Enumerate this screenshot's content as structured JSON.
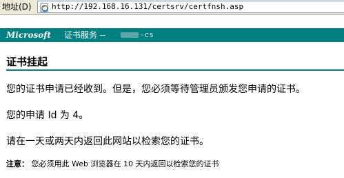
{
  "address_bar": {
    "label": "地址(D)",
    "url": "http://192.168.16.131/certsrv/certfnsh.asp"
  },
  "banner": {
    "brand": "Microsoft",
    "service": "证书服务 --",
    "server_suffix": "-cs"
  },
  "content": {
    "heading": "证书挂起",
    "paragraph_1": "您的证书申请已经收到。但是，您必须等待管理员颁发您申请的证书。",
    "paragraph_2": "您的申请 Id 为 4。",
    "paragraph_3": "请在一天或两天内返回此网站以检索您的证书。",
    "note_label": "注意：",
    "note_text": "您必须用此 Web 浏览器在 10 天内返回以检索您的证书"
  },
  "colors": {
    "banner_bg": "#008080",
    "rule": "#008080",
    "toolbar_bg": "#ece9d8"
  },
  "icons": {
    "page": "ie-page-icon"
  }
}
